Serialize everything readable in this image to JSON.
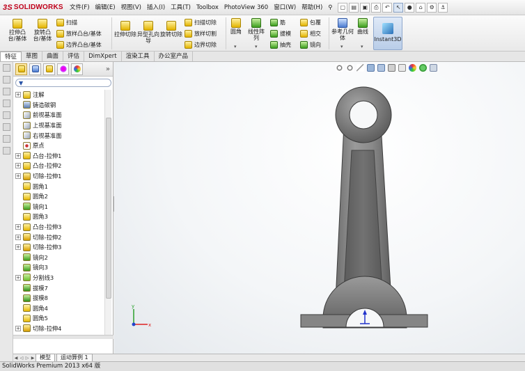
{
  "app": {
    "logo_text": "SOLIDWORKS",
    "logo_prefix": "3S"
  },
  "menu": [
    "文件(F)",
    "编辑(E)",
    "视图(V)",
    "插入(I)",
    "工具(T)",
    "Toolbox",
    "PhotoView 360",
    "窗口(W)",
    "帮助(H)"
  ],
  "ribbon": {
    "extrude_boss": "拉伸凸台/基体",
    "revolve_boss": "旋转凸台/基体",
    "sweep": "扫描",
    "loft": "放样凸台/基体",
    "boundary": "边界凸台/基体",
    "extrude_cut": "拉伸切除",
    "hole_wizard": "异型孔向导",
    "revolve_cut": "旋转切除",
    "swept_cut": "扫描切除",
    "lofted_cut": "放样切割",
    "boundary_cut": "边界切除",
    "fillet": "圆角",
    "linear_pattern": "线性阵列",
    "rib": "筋",
    "draft": "拔模",
    "shell": "抽壳",
    "wrap": "包覆",
    "intersect": "相交",
    "mirror": "镜向",
    "ref_geometry": "参考几何体",
    "curves": "曲线",
    "instant3d": "Instant3D"
  },
  "tabs": [
    "特征",
    "草图",
    "曲面",
    "评估",
    "DimXpert",
    "渲染工具",
    "办公室产品"
  ],
  "feature_tree": [
    {
      "label": "注解",
      "expand": true,
      "icon": "annotation-icon"
    },
    {
      "label": "铸造碳钢",
      "expand": false,
      "icon": "material-icon"
    },
    {
      "label": "前视基准面",
      "expand": false,
      "icon": "plane-icon"
    },
    {
      "label": "上视基准面",
      "expand": false,
      "icon": "plane-icon"
    },
    {
      "label": "右视基准面",
      "expand": false,
      "icon": "plane-icon"
    },
    {
      "label": "原点",
      "expand": false,
      "icon": "origin-icon"
    },
    {
      "label": "凸台-拉伸1",
      "expand": true,
      "icon": "boss-extrude-icon"
    },
    {
      "label": "凸台-拉伸2",
      "expand": true,
      "icon": "boss-extrude-icon"
    },
    {
      "label": "切除-拉伸1",
      "expand": true,
      "icon": "cut-extrude-icon"
    },
    {
      "label": "圆角1",
      "expand": false,
      "icon": "fillet-icon"
    },
    {
      "label": "圆角2",
      "expand": false,
      "icon": "fillet-icon"
    },
    {
      "label": "镜向1",
      "expand": false,
      "icon": "mirror-icon"
    },
    {
      "label": "圆角3",
      "expand": false,
      "icon": "fillet-icon"
    },
    {
      "label": "凸台-拉伸3",
      "expand": true,
      "icon": "boss-extrude-icon"
    },
    {
      "label": "切除-拉伸2",
      "expand": true,
      "icon": "cut-extrude-icon"
    },
    {
      "label": "切除-拉伸3",
      "expand": true,
      "icon": "cut-extrude-icon"
    },
    {
      "label": "镜向2",
      "expand": false,
      "icon": "mirror-icon"
    },
    {
      "label": "镜向3",
      "expand": false,
      "icon": "mirror-icon"
    },
    {
      "label": "分割线3",
      "expand": true,
      "icon": "split-line-icon"
    },
    {
      "label": "拔模7",
      "expand": false,
      "icon": "draft-icon"
    },
    {
      "label": "拔模8",
      "expand": false,
      "icon": "draft-icon"
    },
    {
      "label": "圆角4",
      "expand": false,
      "icon": "fillet-icon"
    },
    {
      "label": "圆角5",
      "expand": false,
      "icon": "fillet-icon"
    },
    {
      "label": "切除-拉伸4",
      "expand": true,
      "icon": "cut-extrude-icon"
    }
  ],
  "model_tabs": [
    "模型",
    "运动算例 1"
  ],
  "status": "SolidWorks Premium 2013 x64 版",
  "triad": {
    "x": "x",
    "y": "y"
  },
  "colors": {
    "brand": "#c0001a",
    "part": "#8a8a8a",
    "selection": "#fbe7a2"
  }
}
